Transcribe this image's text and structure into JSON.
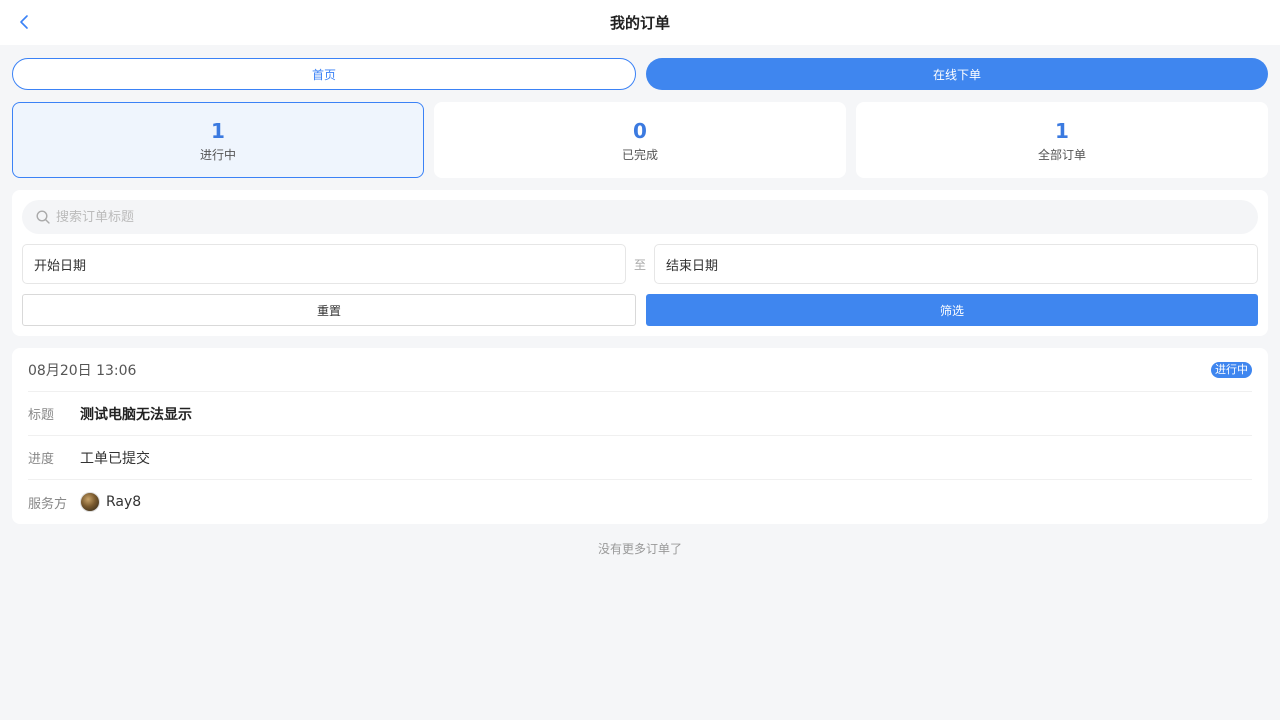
{
  "header": {
    "title": "我的订单"
  },
  "actions": {
    "home_label": "首页",
    "online_order_label": "在线下单"
  },
  "stats": [
    {
      "count": "1",
      "label": "进行中",
      "active": true
    },
    {
      "count": "0",
      "label": "已完成",
      "active": false
    },
    {
      "count": "1",
      "label": "全部订单",
      "active": false
    }
  ],
  "filter": {
    "search_placeholder": "搜索订单标题",
    "start_date": "开始日期",
    "separator": "至",
    "end_date": "结束日期",
    "reset_label": "重置",
    "filter_label": "筛选"
  },
  "orders": [
    {
      "time": "08月20日 13:06",
      "status": "进行中",
      "title_label": "标题",
      "title": "测试电脑无法显示",
      "progress_label": "进度",
      "progress": "工单已提交",
      "provider_label": "服务方",
      "provider": "Ray8"
    }
  ],
  "footer": {
    "no_more": "没有更多订单了"
  },
  "colors": {
    "accent": "#3f86ef",
    "stat_number": "#3b7ae0",
    "background": "#f5f6f8"
  },
  "icons": {
    "back": "chevron-left-icon",
    "search": "search-icon"
  }
}
